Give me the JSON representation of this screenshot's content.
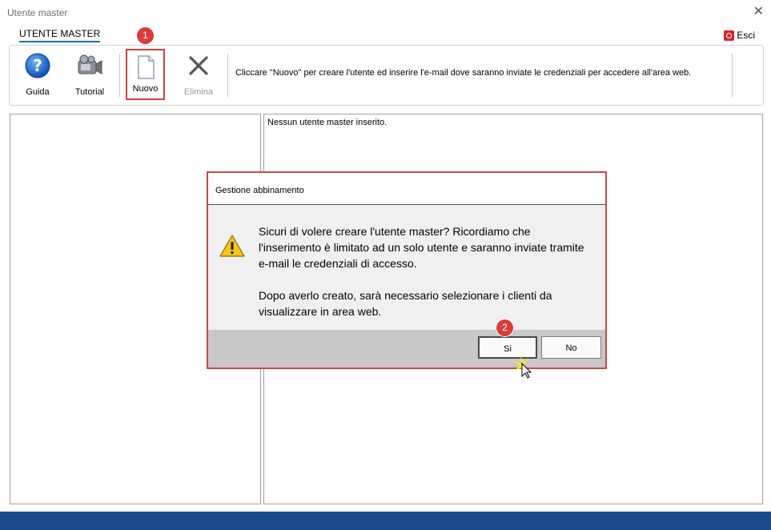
{
  "window": {
    "title": "Utente master"
  },
  "tabs": [
    {
      "label": "UTENTE MASTER"
    }
  ],
  "header": {
    "exit_label": "Esci"
  },
  "toolbar": {
    "guida_label": "Guida",
    "tutorial_label": "Tutorial",
    "nuovo_label": "Nuovo",
    "elimina_label": "Elimina",
    "info_text": "Cliccare \"Nuovo\" per creare l'utente ed inserire l'e-mail dove saranno inviate le credenziali per accedere all'area web."
  },
  "main": {
    "right_panel_message": "Nessun utente master inserito."
  },
  "annotations": {
    "step1": "1",
    "step2": "2"
  },
  "dialog": {
    "title": "Gestione abbinamento",
    "paragraph1": "Sicuri di volere creare l'utente master? Ricordiamo che l'inserimento è limitato ad un solo utente e saranno inviate tramite e-mail le credenziali di accesso.",
    "paragraph2": "Dopo averlo creato, sarà necessario selezionare i clienti da visualizzare in area web.",
    "yes_label": "Si",
    "no_label": "No"
  },
  "colors": {
    "highlight": "#d04545",
    "badge": "#db3b3b",
    "statusbar": "#1d4a8c",
    "tab_underline": "#1f6fb5"
  },
  "icons": [
    "help-icon",
    "video-camera-icon",
    "new-document-icon",
    "delete-x-icon",
    "exit-icon",
    "warning-icon",
    "mouse-cursor-icon",
    "close-icon"
  ]
}
